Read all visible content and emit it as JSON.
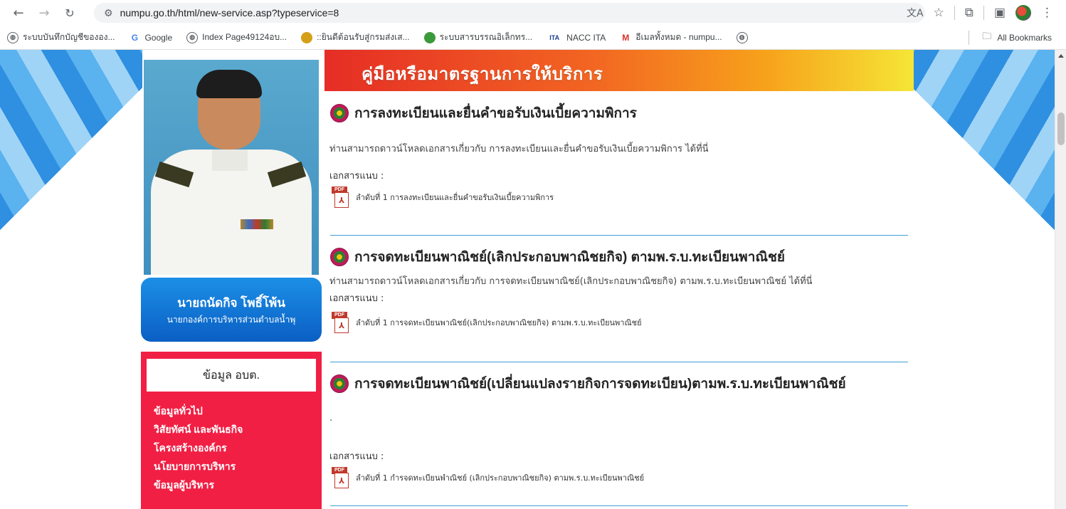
{
  "browser": {
    "url": "numpu.go.th/html/new-service.asp?typeservice=8",
    "bookmarks": [
      {
        "label": "ระบบบันทึกบัญชีขององ...",
        "icon": "globe-icon"
      },
      {
        "label": "Google",
        "icon": "google-icon"
      },
      {
        "label": "Index Page49124อบ...",
        "icon": "globe-icon"
      },
      {
        "label": "::ยินดีต้อนรับสู่กรมส่งเส...",
        "icon": "seal-icon"
      },
      {
        "label": "ระบบสารบรรณอิเล็กทร...",
        "icon": "seal-icon"
      },
      {
        "label": "NACC ITA",
        "icon": "ita-icon"
      },
      {
        "label": "อีเมลทั้งหมด - numpu...",
        "icon": "gmail-icon"
      },
      {
        "label": "",
        "icon": "globe-icon"
      }
    ],
    "all_bookmarks": "All Bookmarks"
  },
  "sidebar": {
    "executive_name": "นายถนัดกิจ โพธิ์โพ้น",
    "executive_title": "นายกองค์การบริหารส่วนตำบลน้ำพุ",
    "info_header": "ข้อมูล อบต.",
    "links": [
      "ข้อมูลทั่วไป",
      "วิสัยทัศน์ และพันธกิจ",
      "โครงสร้างองค์กร",
      "นโยบายการบริหาร",
      "ข้อมูลผู้บริหาร"
    ]
  },
  "main": {
    "banner": "คู่มือหรือมาตรฐานการให้บริการ",
    "attachment_label": "เอกสารแนบ :",
    "services": [
      {
        "title": "การลงทะเบียนและยื่นคำขอรับเงินเบี้ยความพิการ",
        "description": "ท่านสามารถดาวน์โหลดเอกสารเกี่ยวกับ การลงทะเบียนและยื่นคำขอรับเงินเบี้ยความพิการ ได้ที่นี่",
        "file": "ลำดับที่ 1 การลงทะเบียนและยื่นคำขอรับเงินเบี้ยความพิการ"
      },
      {
        "title": "การจดทะเบียนพาณิชย์(เลิกประกอบพาณิชยกิจ) ตามพ.ร.บ.ทะเบียนพาณิชย์",
        "description": "ท่านสามารถดาวน์โหลดเอกสารเกี่ยวกับ การจดทะเบียนพาณิชย์(เลิกประกอบพาณิชยกิจ) ตามพ.ร.บ.ทะเบียนพาณิชย์ ได้ที่นี่",
        "file": "ลำดับที่ 1 การจดทะเบียนพาณิชย์(เลิกประกอบพาณิชยกิจ) ตามพ.ร.บ.ทะเบียนพาณิชย์"
      },
      {
        "title": "การจดทะเบียนพาณิชย์(เปลี่ยนแปลงรายกิจการจดทะเบียน)ตามพ.ร.บ.ทะเบียนพาณิชย์",
        "description": ".",
        "file": "ลำดับที่ 1 กำรจดทะเบียนพำณิชย์ (เลิกประกอบพาณิชยกิจ) ตามพ.ร.บ.ทะเบียนพาณิชย์"
      }
    ]
  }
}
